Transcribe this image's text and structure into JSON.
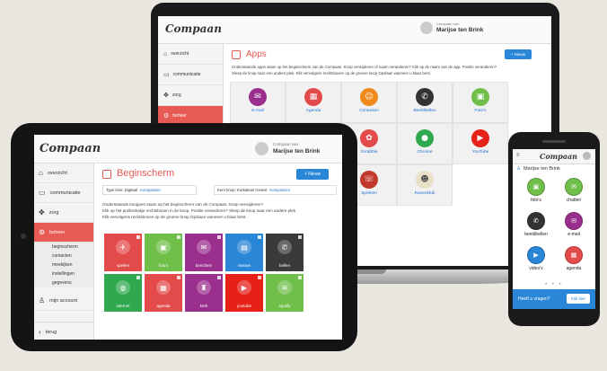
{
  "laptop": {
    "logo": "Compaan",
    "user_prefix": "Compaan van",
    "user_name": "Marijse ten Brink",
    "sidebar": [
      {
        "label": "overzicht",
        "icon": "home-icon"
      },
      {
        "label": "communicatie",
        "icon": "chat-icon"
      },
      {
        "label": "zorg",
        "icon": "move-icon"
      },
      {
        "label": "beheer",
        "icon": "gear-icon"
      }
    ],
    "sidebar_sub": [
      "apps"
    ],
    "page_title": "Apps",
    "new_button": "+ Nieuw",
    "intro_1": "Onderstaande apps staan op het beginscherm van de Compaan. Knop verwijderen of naam veranderen? Klik op de naam van de app. Positie veranderen?",
    "intro_2": "Sleep de knop naar een andere plek. Klik vervolgens rechtsboven op de groene knop Opslaan wanneer u klaar bent.",
    "apps": [
      {
        "label": "E-mail",
        "color": "#9b2f8e",
        "glyph": "✉"
      },
      {
        "label": "Agenda",
        "color": "#e34b4b",
        "glyph": "▦"
      },
      {
        "label": "Contacten",
        "color": "#f08a1c",
        "glyph": "☺"
      },
      {
        "label": "Beeldbellen",
        "color": "#333333",
        "glyph": "✆"
      },
      {
        "label": "Foto's",
        "color": "#6fbf4a",
        "glyph": "▣"
      },
      {
        "label": "Facebook",
        "color": "#3b5998",
        "glyph": "f"
      },
      {
        "label": "Nieuws",
        "color": "#2a86d6",
        "glyph": "▤"
      },
      {
        "label": "Scrabble",
        "color": "#e34b4b",
        "glyph": "✿"
      },
      {
        "label": "Chrome",
        "color": "#2fa84f",
        "glyph": "●"
      },
      {
        "label": "YouTube",
        "color": "#e62117",
        "glyph": "▶"
      },
      {
        "label": "Instellingen",
        "color": "#333333",
        "glyph": "⚙"
      },
      {
        "label": "Help",
        "color": "#2a86d6",
        "glyph": "?"
      },
      {
        "label": "Spreken",
        "color": "#c0392b",
        "glyph": "☏"
      },
      {
        "label": "Ravenklub",
        "color": "#e8e0c8",
        "glyph": "☻"
      }
    ]
  },
  "tablet": {
    "logo": "Compaan",
    "user_prefix": "Compaan van",
    "user_name": "Marijse ten Brink",
    "sidebar": [
      {
        "label": "overzicht",
        "icon": "home-icon"
      },
      {
        "label": "communicatie",
        "icon": "chat-icon"
      },
      {
        "label": "zorg",
        "icon": "move-icon"
      },
      {
        "label": "beheer",
        "icon": "gear-icon"
      }
    ],
    "sidebar_sub": [
      "beginscherm",
      "contacten",
      "meekijken",
      "instellingen",
      "gegevens"
    ],
    "account": "mijn account",
    "back": "terug",
    "page_title": "Beginscherm",
    "new_button": "+ Nieuw",
    "type_kind": "Type knie: Digitaal",
    "kompassen": "Kompassen",
    "kern_knop": "Kern knop: Kurkakoel Gewist",
    "kompassen2": "Kompassen",
    "intro_1": "Onderstaande knoppen staan op het beginscherm van de Compaan. Knop verwijderen?",
    "intro_2": "Klik op het prullenbakje rechtsboven in de knop. Positie veranderen? Sleep de knop naar een andere plek.",
    "intro_3": "Klik vervolgens rechtsboven op de groene knop Opslaan wanneer u klaar bent.",
    "tiles": [
      {
        "label": "spellen",
        "color": "#e34b4b",
        "glyph": "✈"
      },
      {
        "label": "foto's",
        "color": "#6fbf4a",
        "glyph": "▣"
      },
      {
        "label": "berichten",
        "color": "#9b2f8e",
        "glyph": "✉"
      },
      {
        "label": "nieuws",
        "color": "#2a86d6",
        "glyph": "▤"
      },
      {
        "label": "bellen",
        "color": "#3a3a3a",
        "glyph": "✆"
      },
      {
        "label": "internet",
        "color": "#2fa84f",
        "glyph": "◍"
      },
      {
        "label": "agenda",
        "color": "#e34b4b",
        "glyph": "▦"
      },
      {
        "label": "kerk",
        "color": "#9b2f8e",
        "glyph": "♜"
      },
      {
        "label": "youtube",
        "color": "#e62117",
        "glyph": "▶"
      },
      {
        "label": "spotify",
        "color": "#6fbf4a",
        "glyph": "≋"
      }
    ]
  },
  "phone": {
    "logo": "Compaan",
    "user_name": "Marijse ten Brink",
    "tiles": [
      {
        "label": "foto's",
        "color": "#6fbf4a",
        "glyph": "▣"
      },
      {
        "label": "chatten",
        "color": "#6fbf4a",
        "glyph": "✉"
      },
      {
        "label": "beeldbellen",
        "color": "#333333",
        "glyph": "✆"
      },
      {
        "label": "e-mail",
        "color": "#9b2f8e",
        "glyph": "✉"
      },
      {
        "label": "video's",
        "color": "#2a86d6",
        "glyph": "▶"
      },
      {
        "label": "agenda",
        "color": "#e34b4b",
        "glyph": "▦"
      }
    ],
    "help_text": "Heeft u vragen?",
    "help_button": "Klik hier"
  }
}
